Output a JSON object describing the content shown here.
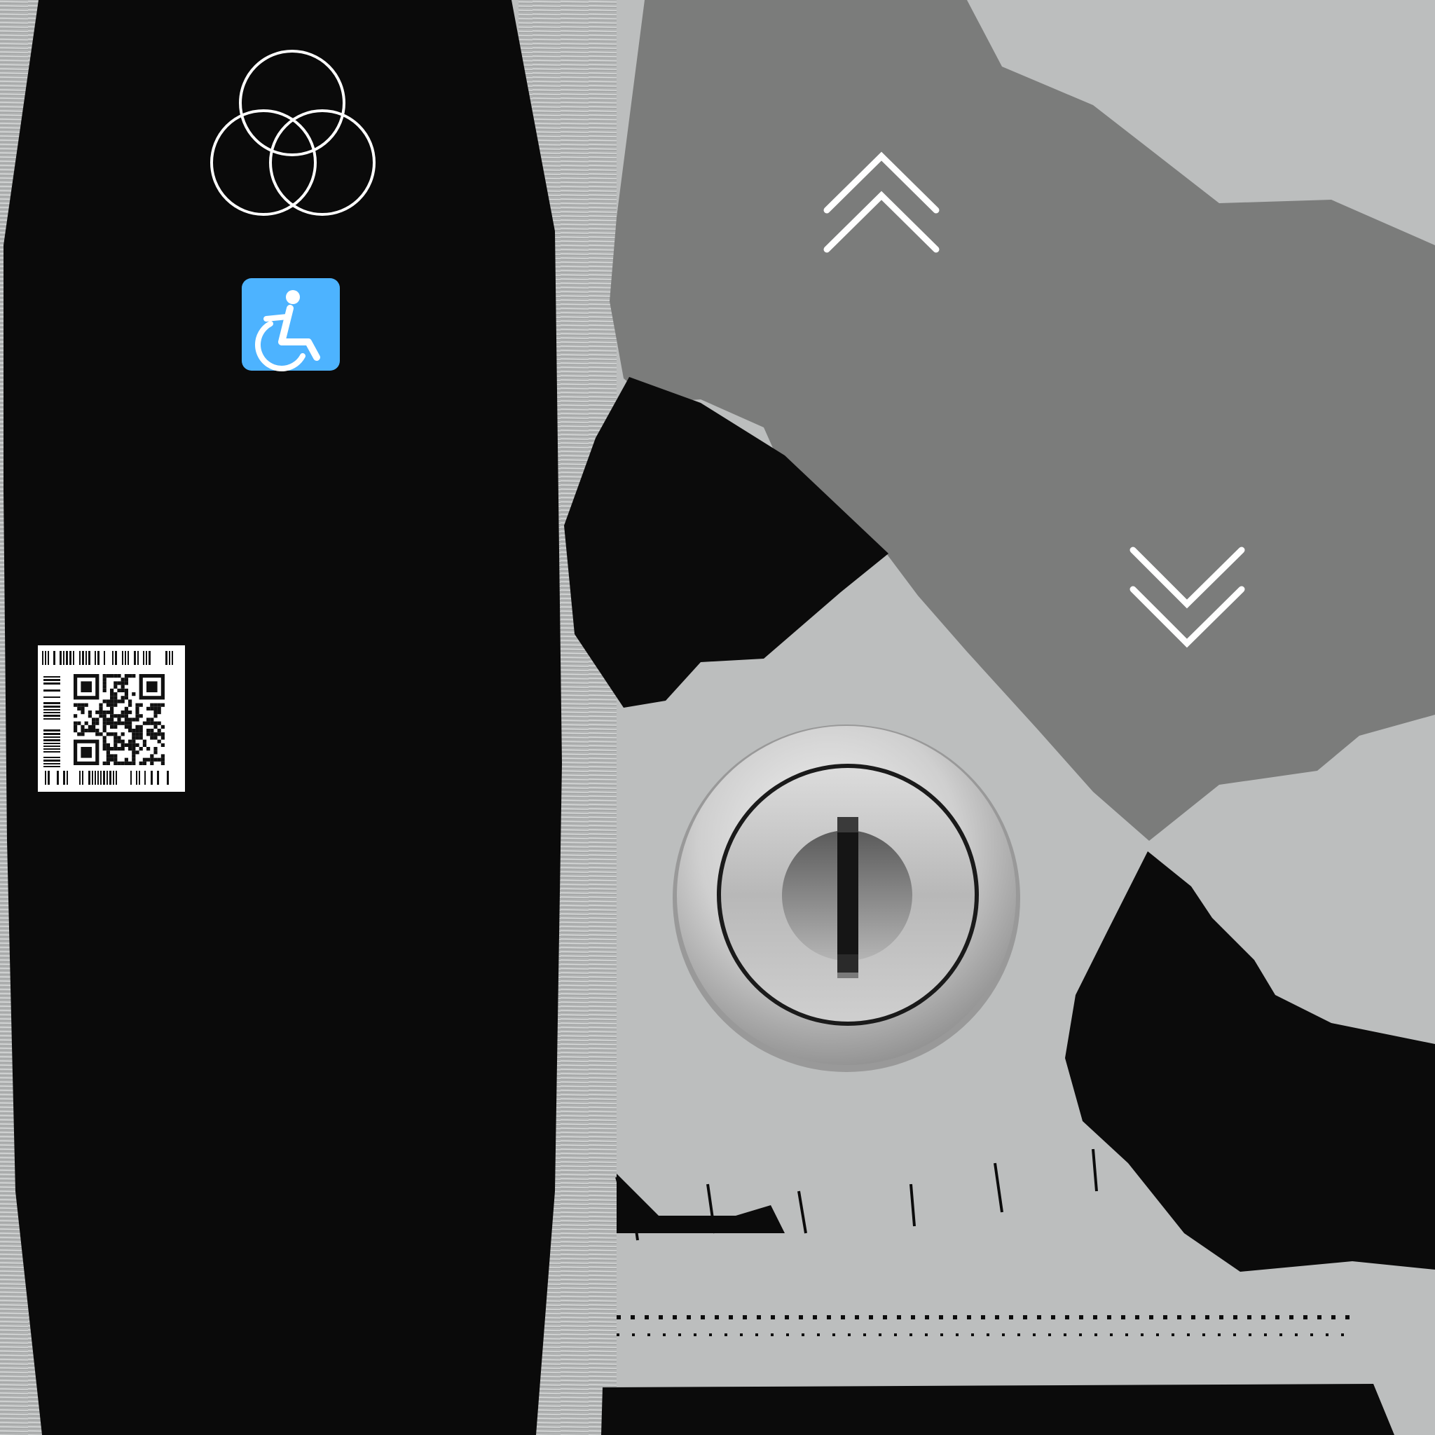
{
  "texture": {
    "panel_color": "#0a0a0a",
    "metal_light": "#bcbebe",
    "metal_mid": "#7b7c7b",
    "metal_dark": "#0b0b0b",
    "accent_color": "#4db3ff"
  },
  "icons": {
    "logo": "three-ring-logo-icon",
    "accessibility": "wheelchair-accessibility-icon",
    "code": "qr-code-label-icon",
    "up": "double-chevron-up-icon",
    "down": "double-chevron-down-icon",
    "lock": "key-lock-icon"
  },
  "controls": {
    "up_button": "up",
    "down_button": "down",
    "key_switch": "lock"
  }
}
